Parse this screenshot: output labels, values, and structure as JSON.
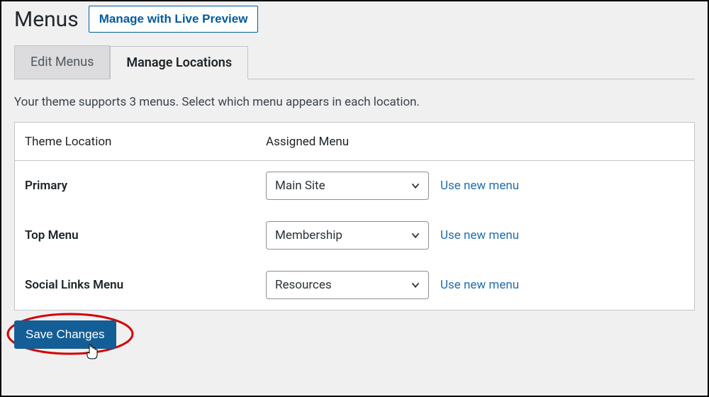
{
  "header": {
    "title": "Menus",
    "preview_button": "Manage with Live Preview"
  },
  "tabs": {
    "edit": "Edit Menus",
    "manage": "Manage Locations"
  },
  "helper": "Your theme supports 3 menus. Select which menu appears in each location.",
  "table": {
    "col_location": "Theme Location",
    "col_assigned": "Assigned Menu",
    "rows": [
      {
        "location": "Primary",
        "selected": "Main Site",
        "new_link": "Use new menu"
      },
      {
        "location": "Top Menu",
        "selected": "Membership",
        "new_link": "Use new menu"
      },
      {
        "location": "Social Links Menu",
        "selected": "Resources",
        "new_link": "Use new menu"
      }
    ]
  },
  "submit": {
    "save": "Save Changes"
  }
}
